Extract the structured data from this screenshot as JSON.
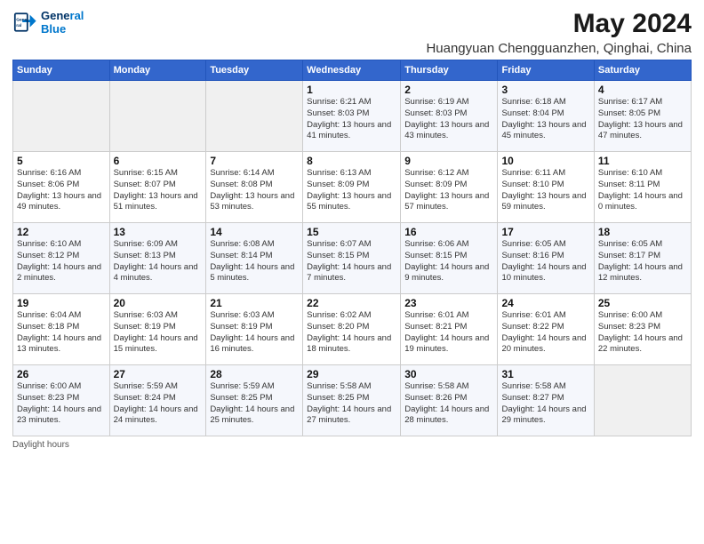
{
  "logo": {
    "line1": "General",
    "line2": "Blue"
  },
  "title": "May 2024",
  "subtitle": "Huangyuan Chengguanzhen, Qinghai, China",
  "days_of_week": [
    "Sunday",
    "Monday",
    "Tuesday",
    "Wednesday",
    "Thursday",
    "Friday",
    "Saturday"
  ],
  "weeks": [
    [
      {
        "day": null
      },
      {
        "day": null
      },
      {
        "day": null
      },
      {
        "day": "1",
        "sunrise": "6:21 AM",
        "sunset": "8:03 PM",
        "daylight": "13 hours and 41 minutes."
      },
      {
        "day": "2",
        "sunrise": "6:19 AM",
        "sunset": "8:03 PM",
        "daylight": "13 hours and 43 minutes."
      },
      {
        "day": "3",
        "sunrise": "6:18 AM",
        "sunset": "8:04 PM",
        "daylight": "13 hours and 45 minutes."
      },
      {
        "day": "4",
        "sunrise": "6:17 AM",
        "sunset": "8:05 PM",
        "daylight": "13 hours and 47 minutes."
      }
    ],
    [
      {
        "day": "5",
        "sunrise": "6:16 AM",
        "sunset": "8:06 PM",
        "daylight": "13 hours and 49 minutes."
      },
      {
        "day": "6",
        "sunrise": "6:15 AM",
        "sunset": "8:07 PM",
        "daylight": "13 hours and 51 minutes."
      },
      {
        "day": "7",
        "sunrise": "6:14 AM",
        "sunset": "8:08 PM",
        "daylight": "13 hours and 53 minutes."
      },
      {
        "day": "8",
        "sunrise": "6:13 AM",
        "sunset": "8:09 PM",
        "daylight": "13 hours and 55 minutes."
      },
      {
        "day": "9",
        "sunrise": "6:12 AM",
        "sunset": "8:09 PM",
        "daylight": "13 hours and 57 minutes."
      },
      {
        "day": "10",
        "sunrise": "6:11 AM",
        "sunset": "8:10 PM",
        "daylight": "13 hours and 59 minutes."
      },
      {
        "day": "11",
        "sunrise": "6:10 AM",
        "sunset": "8:11 PM",
        "daylight": "14 hours and 0 minutes."
      }
    ],
    [
      {
        "day": "12",
        "sunrise": "6:10 AM",
        "sunset": "8:12 PM",
        "daylight": "14 hours and 2 minutes."
      },
      {
        "day": "13",
        "sunrise": "6:09 AM",
        "sunset": "8:13 PM",
        "daylight": "14 hours and 4 minutes."
      },
      {
        "day": "14",
        "sunrise": "6:08 AM",
        "sunset": "8:14 PM",
        "daylight": "14 hours and 5 minutes."
      },
      {
        "day": "15",
        "sunrise": "6:07 AM",
        "sunset": "8:15 PM",
        "daylight": "14 hours and 7 minutes."
      },
      {
        "day": "16",
        "sunrise": "6:06 AM",
        "sunset": "8:15 PM",
        "daylight": "14 hours and 9 minutes."
      },
      {
        "day": "17",
        "sunrise": "6:05 AM",
        "sunset": "8:16 PM",
        "daylight": "14 hours and 10 minutes."
      },
      {
        "day": "18",
        "sunrise": "6:05 AM",
        "sunset": "8:17 PM",
        "daylight": "14 hours and 12 minutes."
      }
    ],
    [
      {
        "day": "19",
        "sunrise": "6:04 AM",
        "sunset": "8:18 PM",
        "daylight": "14 hours and 13 minutes."
      },
      {
        "day": "20",
        "sunrise": "6:03 AM",
        "sunset": "8:19 PM",
        "daylight": "14 hours and 15 minutes."
      },
      {
        "day": "21",
        "sunrise": "6:03 AM",
        "sunset": "8:19 PM",
        "daylight": "14 hours and 16 minutes."
      },
      {
        "day": "22",
        "sunrise": "6:02 AM",
        "sunset": "8:20 PM",
        "daylight": "14 hours and 18 minutes."
      },
      {
        "day": "23",
        "sunrise": "6:01 AM",
        "sunset": "8:21 PM",
        "daylight": "14 hours and 19 minutes."
      },
      {
        "day": "24",
        "sunrise": "6:01 AM",
        "sunset": "8:22 PM",
        "daylight": "14 hours and 20 minutes."
      },
      {
        "day": "25",
        "sunrise": "6:00 AM",
        "sunset": "8:23 PM",
        "daylight": "14 hours and 22 minutes."
      }
    ],
    [
      {
        "day": "26",
        "sunrise": "6:00 AM",
        "sunset": "8:23 PM",
        "daylight": "14 hours and 23 minutes."
      },
      {
        "day": "27",
        "sunrise": "5:59 AM",
        "sunset": "8:24 PM",
        "daylight": "14 hours and 24 minutes."
      },
      {
        "day": "28",
        "sunrise": "5:59 AM",
        "sunset": "8:25 PM",
        "daylight": "14 hours and 25 minutes."
      },
      {
        "day": "29",
        "sunrise": "5:58 AM",
        "sunset": "8:25 PM",
        "daylight": "14 hours and 27 minutes."
      },
      {
        "day": "30",
        "sunrise": "5:58 AM",
        "sunset": "8:26 PM",
        "daylight": "14 hours and 28 minutes."
      },
      {
        "day": "31",
        "sunrise": "5:58 AM",
        "sunset": "8:27 PM",
        "daylight": "14 hours and 29 minutes."
      },
      {
        "day": null
      }
    ]
  ],
  "footer": "Daylight hours"
}
